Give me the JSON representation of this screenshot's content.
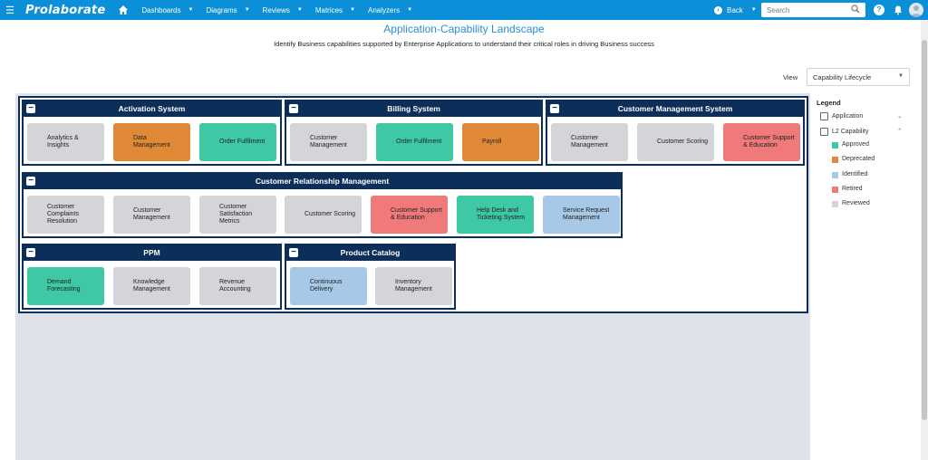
{
  "topbar": {
    "menu_icon": "hamburger-icon",
    "brand": "Prolaborate",
    "home_icon": "home-icon",
    "nav": [
      {
        "label": "Dashboards"
      },
      {
        "label": "Diagrams"
      },
      {
        "label": "Reviews"
      },
      {
        "label": "Matrices"
      },
      {
        "label": "Analyzers"
      }
    ],
    "back_label": "Back",
    "search_placeholder": "Search",
    "help_label": "?"
  },
  "page": {
    "title": "Application-Capability Landscape",
    "subtitle": "Identify Business capabilities supported by Enterprise Applications to understand their critical roles in driving Business success",
    "view_label": "View",
    "view_value": "Capability Lifecycle"
  },
  "colors": {
    "Approved": "#3ec8a6",
    "Deprecated": "#e08a37",
    "Identified": "#a7c8e6",
    "Retired": "#f07a7a",
    "Reviewed": "#d3d5d9",
    "header": "#0c2f5a",
    "brand": "#0a8fd8"
  },
  "groups": [
    {
      "title": "Activation System",
      "toggle": "−",
      "capabilities": [
        {
          "label": "Analytics & Insights",
          "status": "Reviewed"
        },
        {
          "label": "Data Management",
          "status": "Deprecated"
        },
        {
          "label": "Order Fulfilment",
          "status": "Approved"
        }
      ]
    },
    {
      "title": "Billing System",
      "toggle": "−",
      "capabilities": [
        {
          "label": "Customer Management",
          "status": "Reviewed"
        },
        {
          "label": "Order Fulfilment",
          "status": "Approved"
        },
        {
          "label": "Payroll",
          "status": "Deprecated"
        }
      ]
    },
    {
      "title": "Customer Management System",
      "toggle": "−",
      "capabilities": [
        {
          "label": "Customer Management",
          "status": "Reviewed"
        },
        {
          "label": "Customer Scoring",
          "status": "Reviewed"
        },
        {
          "label": "Customer Support & Education",
          "status": "Retired"
        }
      ]
    },
    {
      "title": "Customer Relationship Management",
      "toggle": "−",
      "capabilities": [
        {
          "label": "Customer Complaints Resolution",
          "status": "Reviewed"
        },
        {
          "label": "Customer Management",
          "status": "Reviewed"
        },
        {
          "label": "Customer Satisfaction Metrics",
          "status": "Reviewed"
        },
        {
          "label": "Customer Scoring",
          "status": "Reviewed"
        },
        {
          "label": "Customer Support & Education",
          "status": "Retired"
        },
        {
          "label": "Help Desk and Ticketing System",
          "status": "Approved"
        },
        {
          "label": "Service Request Management",
          "status": "Identified"
        }
      ]
    },
    {
      "title": "PPM",
      "toggle": "−",
      "capabilities": [
        {
          "label": "Demand Forecasting",
          "status": "Approved"
        },
        {
          "label": "Knowledge Management",
          "status": "Reviewed"
        },
        {
          "label": "Revenue Accounting",
          "status": "Reviewed"
        }
      ]
    },
    {
      "title": "Product Catalog",
      "toggle": "−",
      "capabilities": [
        {
          "label": "Continuous Delivery",
          "status": "Identified"
        },
        {
          "label": "Inventory Management",
          "status": "Reviewed"
        }
      ]
    }
  ],
  "legend": {
    "title": "Legend",
    "filters": [
      {
        "label": "Application",
        "expanded": false
      },
      {
        "label": "L2 Capability",
        "expanded": true
      }
    ],
    "items": [
      {
        "label": "Approved",
        "status": "Approved"
      },
      {
        "label": "Deprecated",
        "status": "Deprecated"
      },
      {
        "label": "Identified",
        "status": "Identified"
      },
      {
        "label": "Retired",
        "status": "Retired"
      },
      {
        "label": "Reviewed",
        "status": "Reviewed"
      }
    ]
  }
}
